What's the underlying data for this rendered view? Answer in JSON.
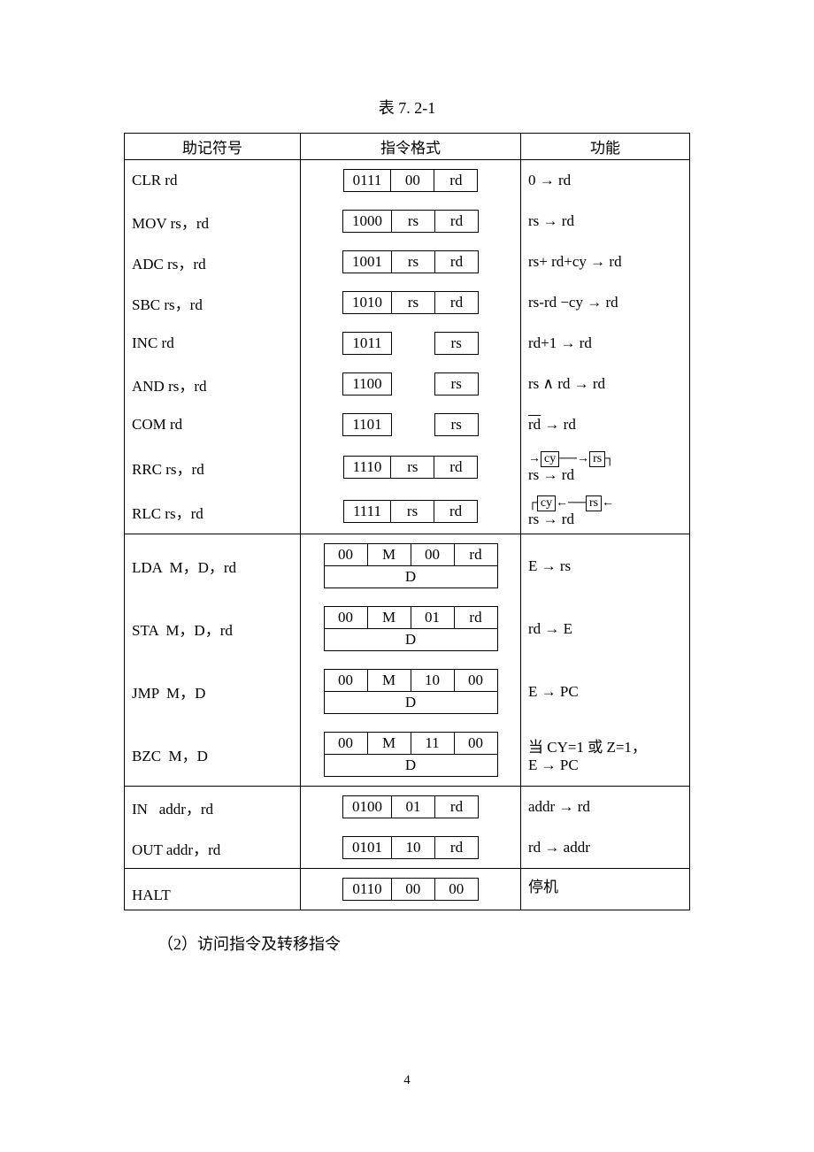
{
  "title_prefix": "表 ",
  "title_number": "7. 2-1",
  "headers": {
    "mnemonic": "助记符号",
    "format": "指令格式",
    "function": "功能"
  },
  "rows": [
    {
      "mn": "CLR rd",
      "op": "0111",
      "f1": "00",
      "f2": "rd",
      "fn_html": "0 → rd"
    },
    {
      "mn": "MOV rs，rd",
      "op": "1000",
      "f1": "rs",
      "f2": "rd",
      "fn_html": "rs → rd"
    },
    {
      "mn": "ADC rs，rd",
      "op": "1001",
      "f1": "rs",
      "f2": "rd",
      "fn_html": "rs+ rd+cy → rd"
    },
    {
      "mn": "SBC rs，rd",
      "op": "1010",
      "f1": "rs",
      "f2": "rd",
      "fn_html": "rs-rd −cy → rd"
    },
    {
      "mn": "INC rd",
      "op": "1011",
      "f1": "",
      "f2": "rs",
      "fn_html": "rd+1 → rd"
    },
    {
      "mn": "AND rs，rd",
      "op": "1100",
      "f1": "",
      "f2": "rs",
      "fn_html": "rs ∧ rd → rd"
    },
    {
      "mn": "COM rd",
      "op": "1101",
      "f1": "",
      "f2": "rs",
      "fn_html": "<span class=\"ovl\">rd</span> → rd"
    },
    {
      "mn": "RRC rs，rd",
      "op": "1110",
      "f1": "rs",
      "f2": "rd",
      "fn_html": "<span class=\"rot\"><span class=\"rrow\"><span class=\"rarr\">→</span><span class=\"rbox\">cy</span><span class=\"rarr\">──→</span><span class=\"rbox\">rs</span><span class=\"rarr\">┐</span></span><br>rs → rd</span>"
    },
    {
      "mn": "RLC rs，rd",
      "op": "1111",
      "f1": "rs",
      "f2": "rd",
      "fn_html": "<span class=\"rot\"><span class=\"rrow\"><span class=\"rarr\">┌</span><span class=\"rbox\">cy</span><span class=\"rarr\">←──</span><span class=\"rbox\">rs</span><span class=\"rarr\">←</span></span><br>rs → rd</span>"
    }
  ],
  "rows2": [
    {
      "mn": "LDA  M，D，rd",
      "p1": "00",
      "p2": "M",
      "p3": "00",
      "p4": "rd",
      "d": "D",
      "fn_html": "E → rs"
    },
    {
      "mn": "STA  M，D，rd",
      "p1": "00",
      "p2": "M",
      "p3": "01",
      "p4": "rd",
      "d": "D",
      "fn_html": "rd → E"
    },
    {
      "mn": "JMP  M，D",
      "p1": "00",
      "p2": "M",
      "p3": "10",
      "p4": "00",
      "d": "D",
      "fn_html": "E → PC"
    },
    {
      "mn": "BZC  M，D",
      "p1": "00",
      "p2": "M",
      "p3": "11",
      "p4": "00",
      "d": "D",
      "fn_html": "当 CY=1 或 Z=1，<br>E → PC"
    }
  ],
  "rows3": [
    {
      "mn": "IN   addr，rd",
      "op": "0100",
      "f1": "01",
      "f2": "rd",
      "fn_html": "addr → rd"
    },
    {
      "mn": "OUT addr，rd",
      "op": "0101",
      "f1": "10",
      "f2": "rd",
      "fn_html": "rd → addr"
    }
  ],
  "rows4": [
    {
      "mn": "HALT",
      "op": "0110",
      "f1": "00",
      "f2": "00",
      "fn_html": "停机"
    }
  ],
  "paragraph": "（2）访问指令及转移指令",
  "page_number": "4"
}
